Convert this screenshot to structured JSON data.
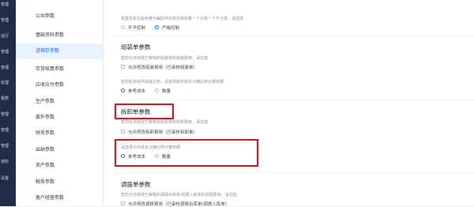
{
  "nav": [
    "管理",
    "管理",
    "运行",
    "管理",
    "管理",
    "处理",
    "报表",
    "管理",
    "管理",
    "管理",
    "资料",
    "设置"
  ],
  "menu": {
    "items": [
      "公共参数",
      "基础资料参数",
      "进销存参数",
      "存货核算参数",
      "应收应付参数",
      "生产参数",
      "委外参数",
      "财务参数",
      "出纳参数",
      "资产参数",
      "税务参数",
      "客户经营参数"
    ],
    "active_index": 2
  },
  "top_hint": "若基本单位库存量与辅助浮动单位库存量一个为零一个不为零，请选择",
  "top_options": [
    "不予控制",
    "严格控制"
  ],
  "assemble": {
    "title": "组装单参数",
    "hint1": "若您允许修改已审核的组装单的组装费用，请勾选",
    "check_label": "允许修改组装费用（已审核组装单）",
    "hint2": "若您有多组件组装业务，请选择组件成本分摊比例计算依据",
    "options": [
      "参考成本",
      "数量"
    ]
  },
  "disassemble": {
    "title": "拆卸单参数",
    "hint1": "若您允许修改已审核的拆卸单的拆卸费用，请勾选",
    "check_label": "允许修改拆卸费用（已审核拆卸单）",
    "hint2": "请选择子件成本分摊比例计算依据",
    "options": [
      "参考成本",
      "数量"
    ]
  },
  "transfer": {
    "title": "调拨单参数",
    "hint1": "若您允许修改已审核的调拨出库单/调拨入库单的调拨费用，请勾选",
    "check_label": "允许修改调拨费用（已审核调拨出库单/调拨入库单）"
  },
  "colors": {
    "accent": "#1b6af0",
    "highlight": "#d0151b",
    "nav_bg": "#1f2d4a"
  }
}
